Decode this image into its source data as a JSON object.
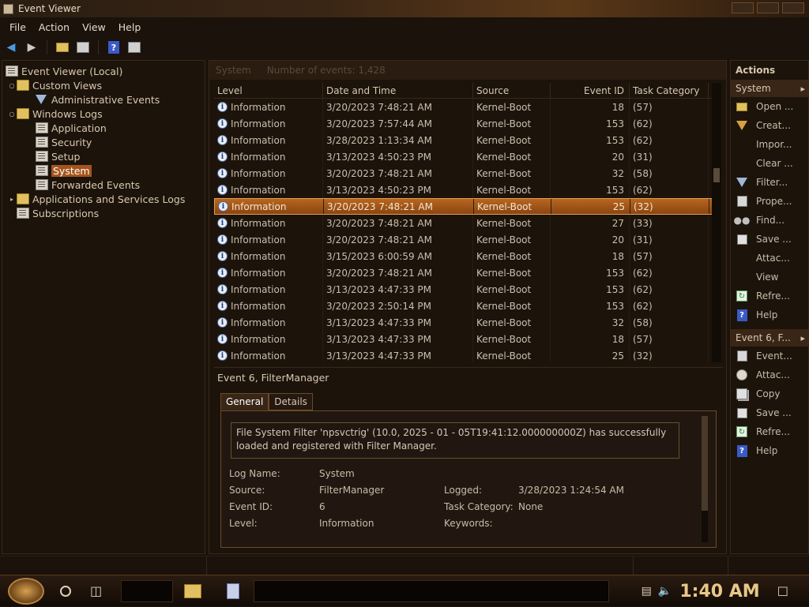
{
  "window": {
    "title": "Event Viewer"
  },
  "menu": [
    "File",
    "Action",
    "View",
    "Help"
  ],
  "tree": {
    "root": "Event Viewer (Local)",
    "custom_views": "Custom Views",
    "admin_events": "Administrative Events",
    "windows_logs": "Windows Logs",
    "application": "Application",
    "security": "Security",
    "setup": "Setup",
    "system": "System",
    "forwarded": "Forwarded Events",
    "apps_services": "Applications and Services Logs",
    "subscriptions": "Subscriptions"
  },
  "grid": {
    "title": "System",
    "count": "Number of events: 1,428",
    "columns": [
      "Level",
      "Date and Time",
      "Source",
      "Event ID",
      "Task Category"
    ],
    "selected_index": 6,
    "rows": [
      [
        "Information",
        "3/20/2023 7:48:21 AM",
        "Kernel-Boot",
        "18",
        "(57)"
      ],
      [
        "Information",
        "3/20/2023 7:57:44 AM",
        "Kernel-Boot",
        "153",
        "(62)"
      ],
      [
        "Information",
        "3/28/2023 1:13:34 AM",
        "Kernel-Boot",
        "153",
        "(62)"
      ],
      [
        "Information",
        "3/13/2023 4:50:23 PM",
        "Kernel-Boot",
        "20",
        "(31)"
      ],
      [
        "Information",
        "3/20/2023 7:48:21 AM",
        "Kernel-Boot",
        "32",
        "(58)"
      ],
      [
        "Information",
        "3/13/2023 4:50:23 PM",
        "Kernel-Boot",
        "153",
        "(62)"
      ],
      [
        "Information",
        "3/20/2023 7:48:21 AM",
        "Kernel-Boot",
        "25",
        "(32)"
      ],
      [
        "Information",
        "3/20/2023 7:48:21 AM",
        "Kernel-Boot",
        "27",
        "(33)"
      ],
      [
        "Information",
        "3/20/2023 7:48:21 AM",
        "Kernel-Boot",
        "20",
        "(31)"
      ],
      [
        "Information",
        "3/15/2023 6:00:59 AM",
        "Kernel-Boot",
        "18",
        "(57)"
      ],
      [
        "Information",
        "3/20/2023 7:48:21 AM",
        "Kernel-Boot",
        "153",
        "(62)"
      ],
      [
        "Information",
        "3/13/2023 4:47:33 PM",
        "Kernel-Boot",
        "153",
        "(62)"
      ],
      [
        "Information",
        "3/20/2023 2:50:14 PM",
        "Kernel-Boot",
        "153",
        "(62)"
      ],
      [
        "Information",
        "3/13/2023 4:47:33 PM",
        "Kernel-Boot",
        "32",
        "(58)"
      ],
      [
        "Information",
        "3/13/2023 4:47:33 PM",
        "Kernel-Boot",
        "18",
        "(57)"
      ],
      [
        "Information",
        "3/13/2023 4:47:33 PM",
        "Kernel-Boot",
        "25",
        "(32)"
      ]
    ]
  },
  "detail": {
    "header": "Event 6, FilterManager",
    "tab_general": "General",
    "tab_details": "Details",
    "description": "File System Filter 'npsvctrig' (10.0,   2025 - 01 - 05T19:41:12.000000000Z) has successfully loaded and registered with Filter Manager.",
    "log_name_label": "Log Name:",
    "log_name": "System",
    "source_label": "Source:",
    "source": "FilterManager",
    "logged_label": "Logged:",
    "logged": "3/28/2023 1:24:54 AM",
    "event_id_label": "Event ID:",
    "event_id": "6",
    "task_cat_label": "Task Category:",
    "task_cat": "None",
    "level_label": "Level:",
    "level": "Information",
    "keywords_label": "Keywords:"
  },
  "actions": {
    "title": "Actions",
    "group1": "System",
    "group2": "Event 6, F...",
    "items1": [
      {
        "label": "Open ...",
        "icon": "folder-open-icon"
      },
      {
        "label": "Creat...",
        "icon": "filter-create-icon"
      },
      {
        "label": "Impor...",
        "icon": "none"
      },
      {
        "label": "Clear ...",
        "icon": "none"
      },
      {
        "label": "Filter...",
        "icon": "filter-icon"
      },
      {
        "label": "Prope...",
        "icon": "properties-icon"
      },
      {
        "label": "Find...",
        "icon": "binoculars-icon"
      },
      {
        "label": "Save ...",
        "icon": "save-icon"
      },
      {
        "label": "Attac...",
        "icon": "none"
      },
      {
        "label": "View",
        "icon": "none"
      },
      {
        "label": "Refre...",
        "icon": "refresh-icon"
      },
      {
        "label": "Help",
        "icon": "help-icon"
      }
    ],
    "items2": [
      {
        "label": "Event...",
        "icon": "properties-icon"
      },
      {
        "label": "Attac...",
        "icon": "task-icon"
      },
      {
        "label": "Copy",
        "icon": "copy-icon"
      },
      {
        "label": "Save ...",
        "icon": "save-icon"
      },
      {
        "label": "Refre...",
        "icon": "refresh-icon"
      },
      {
        "label": "Help",
        "icon": "help-icon"
      }
    ]
  },
  "taskbar": {
    "clock": "1:40 AM"
  }
}
